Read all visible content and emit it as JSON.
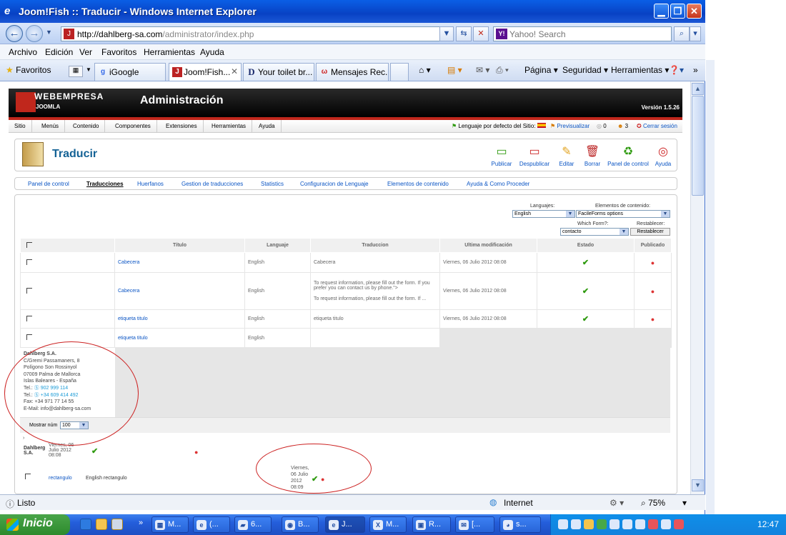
{
  "window": {
    "title": "Joom!Fish :: Traducir - Windows Internet Explorer",
    "minimize": "▁",
    "restore": "❐",
    "close": "✕"
  },
  "browser": {
    "url_host": "http://dahlberg-sa.com",
    "url_path": "/administrator/index.php",
    "search_placeholder": "Yahoo! Search",
    "menu": [
      "Archivo",
      "Edición",
      "Ver",
      "Favoritos",
      "Herramientas",
      "Ayuda"
    ],
    "favorites_label": "Favoritos",
    "tabs": [
      {
        "label": "iGoogle",
        "icon": "igoogle-icon"
      },
      {
        "label": "Joom!Fish...",
        "icon": "joomfish-icon",
        "active": true
      },
      {
        "label": "Your toilet br...",
        "icon": "d-icon"
      },
      {
        "label": "Mensajes Rec...",
        "icon": "mail-icon"
      }
    ],
    "commands": [
      "Página",
      "Seguridad",
      "Herramientas"
    ],
    "status": "Listo",
    "zone": "Internet",
    "zoom": "75%"
  },
  "joomla": {
    "brand": "WEBEMPRESA",
    "brand_sub": "JOOMLA",
    "admin_title": "Administración",
    "version": "Versión 1.5.26",
    "menu": [
      "Sitio",
      "Menús",
      "Contenido",
      "Componentes",
      "Extensiones",
      "Herramientas",
      "Ayuda"
    ],
    "default_lang": "Lenguaje por defecto del Sitio:",
    "preview": "Previsualizar",
    "msg_count": "0",
    "users_count": "3",
    "logout": "Cerrar sesión",
    "page_title": "Traducir",
    "toolbar": [
      "Publicar",
      "Despublicar",
      "Editar",
      "Borrar",
      "Panel de control",
      "Ayuda"
    ],
    "submenu": [
      "Panel de control",
      "Traducciones",
      "Huerfanos",
      "Gestion de traducciones",
      "Statistics",
      "Configuracion de Lenguaje",
      "Elementos de contenido",
      "Ayuda & Como Proceder"
    ],
    "filters": {
      "languages_label": "Languajes:",
      "languages_value": "English",
      "content_label": "Elementos de contenido:",
      "content_value": "FacileForms options",
      "form_label": "Which Form?:",
      "form_value": "contacto",
      "reset_label": "Restablecer:",
      "reset_button": "Restablecer"
    },
    "table": {
      "headers": [
        "Título",
        "Languaje",
        "Traduccion",
        "Ultima modificación",
        "Estado",
        "Publicado"
      ],
      "rows": [
        {
          "title": "Cabecera",
          "lang": "English",
          "trans": "Cabecera",
          "trans2": "",
          "date": "Viernes, 06 Julio 2012 08:08"
        },
        {
          "title": "Cabecera",
          "lang": "English",
          "trans": "To request information, please fill out the form. If you prefer you can contact us by phone.\">",
          "trans2": "To request information, please fill out the form. If ...",
          "date": "Viernes, 06 Julio 2012 08:08"
        },
        {
          "title": "etiqueta titulo",
          "lang": "English",
          "trans": "etiqueta titulo",
          "trans2": "",
          "date": "Viernes, 06 Julio 2012 08:08"
        },
        {
          "title": "etiqueta titulo",
          "lang": "English",
          "trans": "",
          "trans2": "",
          "date": ""
        }
      ]
    },
    "address_card": {
      "name": "Dahlberg S.A.",
      "lines": [
        "C/Gremi Passamaners, 8",
        "Polígono Son Rossinyol",
        "07009 Palma de Mallorca",
        "Islas Baleares - España"
      ],
      "tel1_label": "Tel.:",
      "tel1": "902 999 114",
      "tel2_label": "Tel.:",
      "tel2": "+34 609 414 492",
      "fax": "Fax: +34 971 77 14 55",
      "email": "E-Mail: info@dahlberg-sa.com"
    },
    "pager": {
      "label": "Mostrar núm",
      "value": "100"
    },
    "overflow": {
      "name": "Dahlberg S.A.",
      "date": "Viernes, 06 Julio 2012 08:08",
      "row_title": "rectangulo",
      "row_lang": "English",
      "row_trans": "rectangulo",
      "date2": "Viernes, 06 Julio 2012 08:09"
    }
  },
  "taskbar": {
    "start": "Inicio",
    "tasks": [
      {
        "label": "M...",
        "icon": "window-icon"
      },
      {
        "label": "(...",
        "icon": "ie-icon"
      },
      {
        "label": "6...",
        "icon": "folder-icon"
      },
      {
        "label": "B...",
        "icon": "firefox-icon"
      },
      {
        "label": "J...",
        "icon": "ie-icon",
        "active": true
      },
      {
        "label": "M...",
        "icon": "excel-icon"
      },
      {
        "label": "R...",
        "icon": "app-icon"
      },
      {
        "label": "[...",
        "icon": "mail-icon"
      },
      {
        "label": "s...",
        "icon": "chrome-icon"
      }
    ],
    "clock": "12:47"
  }
}
